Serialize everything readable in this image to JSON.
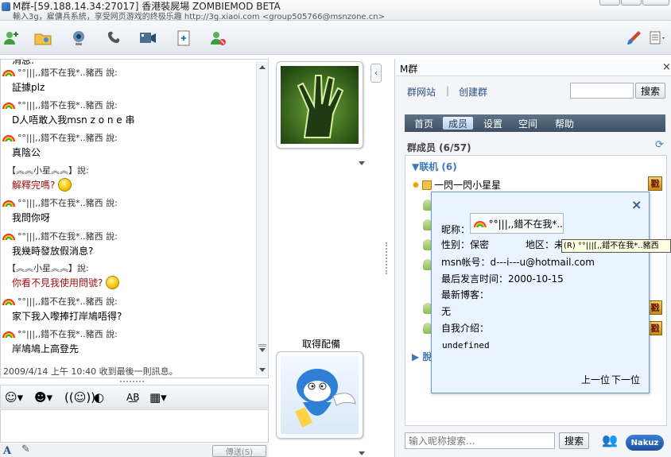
{
  "window": {
    "title": "M群-[59.188.14.34:27017] 香港裝屍場 ZOMBIEMOD BETA",
    "subtitle": "輸入3g，雇傭兵系統，享受网页游戏的终极乐趣 http://3g.xiaoi.com <group505766@msnzone.cn>"
  },
  "toolbar": {
    "icons": [
      "add-contact-icon",
      "share-folder-icon",
      "webcam-icon",
      "call-icon",
      "video-icon",
      "send-file-icon",
      "block-contact-icon",
      "paint-brush-icon",
      "menu-icon"
    ]
  },
  "chat": {
    "messages": [
      {
        "sender": "°°|||,,錯不在我*..豬西 說:",
        "text": "証據plz",
        "color": "normal"
      },
      {
        "sender": "°°|||,,錯不在我*..豬西 說:",
        "text": "D人唔敢入我msn z o n e 串",
        "color": "normal"
      },
      {
        "sender": "°°|||,,錯不在我*..豬西 說:",
        "text": "真陰公",
        "color": "normal"
      },
      {
        "sender": "【︽︽小星︽︽】說:",
        "text": "解釋完嗎?",
        "color": "red",
        "emoticon": "confused-smiley-icon"
      },
      {
        "sender": "°°|||,,錯不在我*..豬西 說:",
        "text": "我問你呀",
        "color": "normal"
      },
      {
        "sender": "°°|||,,錯不在我*..豬西 說:",
        "text": "我幾時發放假消息?",
        "color": "normal"
      },
      {
        "sender": "【︽︽小星︽︽】說:",
        "text": "你看不見我使用問號?",
        "color": "red",
        "emoticon": "confused-smiley-icon"
      },
      {
        "sender": "°°|||,,錯不在我*..豬西 說:",
        "text": "家下我入嚟捧打岸鳩唔得?",
        "color": "normal"
      },
      {
        "sender": "°°|||,,錯不在我*..豬西 說:",
        "text": "岸鳩鳩上高登先",
        "color": "normal"
      }
    ],
    "partial_top": "消息:",
    "status": "2009/4/14 上午 10:40 收到最後一則訊息。"
  },
  "composer": {
    "font_label": "A",
    "send_label": "傳送(S)"
  },
  "middle": {
    "caption": "取得配備"
  },
  "group": {
    "name": "M群",
    "close": "×",
    "links": {
      "site": "群网站",
      "create": "创建群"
    },
    "search_button": "搜索",
    "tabs": [
      {
        "label": "首页",
        "active": false
      },
      {
        "label": "成员",
        "active": true
      },
      {
        "label": "设置",
        "active": false
      },
      {
        "label": "空间",
        "active": false
      },
      {
        "label": "帮助",
        "active": false
      }
    ],
    "members_title": "群成员 (6/57)",
    "online_label": "▼联机 (6)",
    "first_member": "一閃一閃小星星",
    "role_badge": "戳",
    "offline_label": "▶ 脫",
    "member_search_placeholder": "输入昵称搜索...",
    "member_search_button": "搜索",
    "logo_text": "Nakuz"
  },
  "popup": {
    "nick_label": "昵称：",
    "nick_value": "°°|||,,錯不在我*..",
    "gender": "性别：保密",
    "area": "地区：未",
    "msn": "msn帐号：d---i---u@hotmail.com",
    "last_speak": "最后发言时间：2000-10-15",
    "blog": "最新博客：",
    "blog_value": "无",
    "intro": "自我介绍：",
    "intro_value": "undefined",
    "prev": "上一位",
    "next": "下一位",
    "close": "×"
  },
  "tooltip": {
    "text": "(R) °°|||[,,錯不在我*..豬西"
  }
}
